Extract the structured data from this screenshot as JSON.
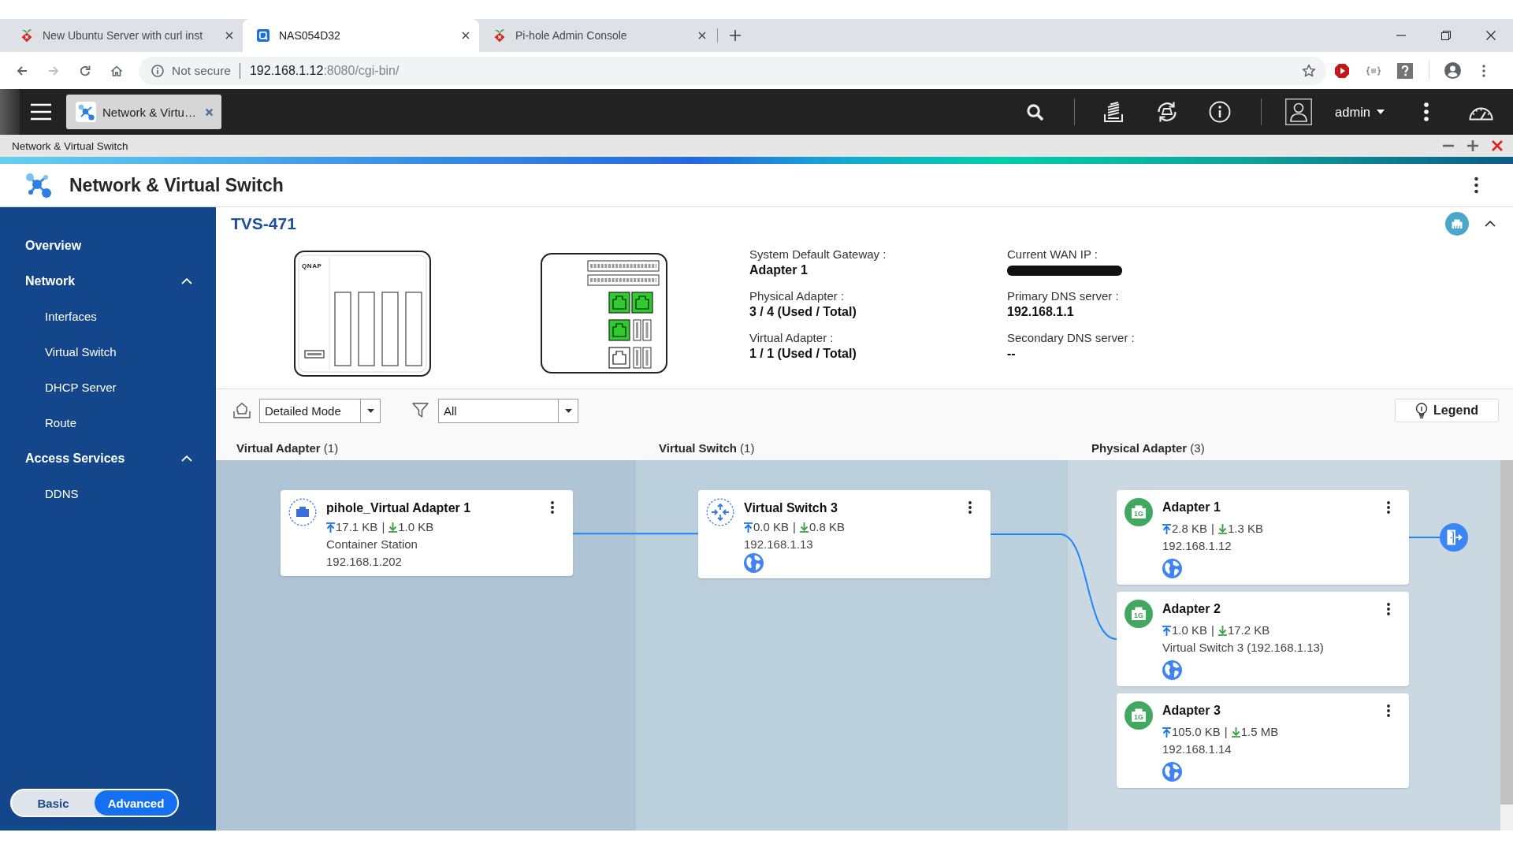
{
  "browser": {
    "tabs": [
      {
        "kind": "berry",
        "title": "New Ubuntu Server with curl inst",
        "selected": false
      },
      {
        "kind": "app",
        "title": "NAS054D32",
        "selected": true
      },
      {
        "kind": "berry",
        "title": "Pi-hole Admin Console",
        "selected": false
      }
    ],
    "address": {
      "security": "Not secure",
      "host": "192.168.1.12",
      "path": ":8080/cgi-bin/"
    }
  },
  "nas_bar": {
    "app_tab": "Network & Virtu…",
    "user": "admin"
  },
  "window": {
    "title": "Network & Virtual Switch"
  },
  "app": {
    "title": "Network & Virtual Switch"
  },
  "sidebar": {
    "items": [
      {
        "kind": "link",
        "label": "Overview"
      },
      {
        "kind": "group",
        "label": "Network",
        "expanded": true,
        "children": [
          {
            "label": "Interfaces"
          },
          {
            "label": "Virtual Switch"
          },
          {
            "label": "DHCP Server"
          },
          {
            "label": "Route"
          }
        ]
      },
      {
        "kind": "group",
        "label": "Access Services",
        "expanded": true,
        "children": [
          {
            "label": "DDNS"
          }
        ]
      }
    ],
    "mode_toggle": [
      {
        "label": "Basic",
        "selected": false
      },
      {
        "label": "Advanced",
        "selected": true
      }
    ]
  },
  "device": {
    "model": "TVS-471",
    "expanded": true,
    "front_logo": "QNAP",
    "ports": [
      {
        "used": true
      },
      {
        "used": true
      },
      {
        "used": true
      },
      {
        "used": false
      }
    ],
    "info_columns": [
      [
        {
          "label": "System Default Gateway :",
          "value": "Adapter 1",
          "redacted": false
        },
        {
          "label": "Physical Adapter :",
          "value": "3 / 4 (Used / Total)",
          "redacted": false
        },
        {
          "label": "Virtual Adapter :",
          "value": "1 / 1 (Used / Total)",
          "redacted": false
        }
      ],
      [
        {
          "label": "Current WAN IP :",
          "redacted": true
        },
        {
          "label": "Primary DNS server :",
          "value": "192.168.1.1",
          "redacted": false
        },
        {
          "label": "Secondary DNS server :",
          "value": "--",
          "redacted": false
        }
      ]
    ]
  },
  "toolbar": {
    "view_mode": "Detailed Mode",
    "filter": "All",
    "legend": "Legend"
  },
  "lanes": [
    {
      "kind": "virtual_adapter",
      "title": "**Virtual Adapter** (1)",
      "nodes": [
        {
          "name": "pihole_Virtual Adapter 1",
          "up": "17.1 KB",
          "separator": "|",
          "down": "1.0 KB",
          "lines": [
            "Container Station",
            "192.168.1.202"
          ],
          "internet": false,
          "switch_link": true
        }
      ]
    },
    {
      "kind": "virtual_switch",
      "title": "**Virtual Switch** (1)",
      "nodes": [
        {
          "name": "Virtual Switch 3",
          "up": "0.0 KB",
          "separator": "|",
          "down": "0.8 KB",
          "lines": [
            "192.168.1.13"
          ],
          "internet": true
        }
      ]
    },
    {
      "kind": "physical_adapter",
      "title": "**Physical Adapter** (3)",
      "nodes": [
        {
          "name": "Adapter 1",
          "speed": "1G",
          "up": "2.8 KB",
          "separator": "|",
          "down": "1.3 KB",
          "lines": [
            "192.168.1.12"
          ],
          "internet": true,
          "switch_link": false,
          "uplink": true
        },
        {
          "name": "Adapter 2",
          "speed": "1G",
          "up": "1.0 KB",
          "separator": "|",
          "down": "17.2 KB",
          "lines": [
            "Virtual Switch 3 (192.168.1.13)"
          ],
          "internet": true,
          "switch_link": true,
          "uplink": false
        },
        {
          "name": "Adapter 3",
          "speed": "1G",
          "up": "105.0 KB",
          "separator": "|",
          "down": "1.5 MB",
          "lines": [
            "192.168.1.14"
          ],
          "internet": true,
          "switch_link": false,
          "uplink": false
        }
      ]
    }
  ]
}
